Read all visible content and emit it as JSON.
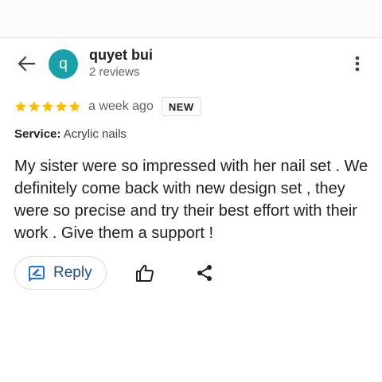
{
  "review": {
    "author": {
      "initial": "q",
      "name": "quyet bui",
      "reviews_count": "2 reviews",
      "avatar_color": "#1aa0a8"
    },
    "rating": 5,
    "time_ago": "a week ago",
    "badge": "NEW",
    "service_label": "Service:",
    "service_value": "Acrylic nails",
    "text": "My sister were so impressed with her nail set . We definitely come back with new design set , they were so precise and try their best effort with their work . Give them a support !"
  },
  "actions": {
    "reply_label": "Reply"
  },
  "icons": {
    "back": "arrow-left-icon",
    "more": "more-vertical-icon",
    "star": "star-icon",
    "reply": "reply-edit-icon",
    "like": "thumbs-up-icon",
    "share": "share-icon"
  },
  "colors": {
    "star": "#fbbc04",
    "accent_blue": "#1a4e8a",
    "reply_icon_blue": "#1a73e8"
  }
}
